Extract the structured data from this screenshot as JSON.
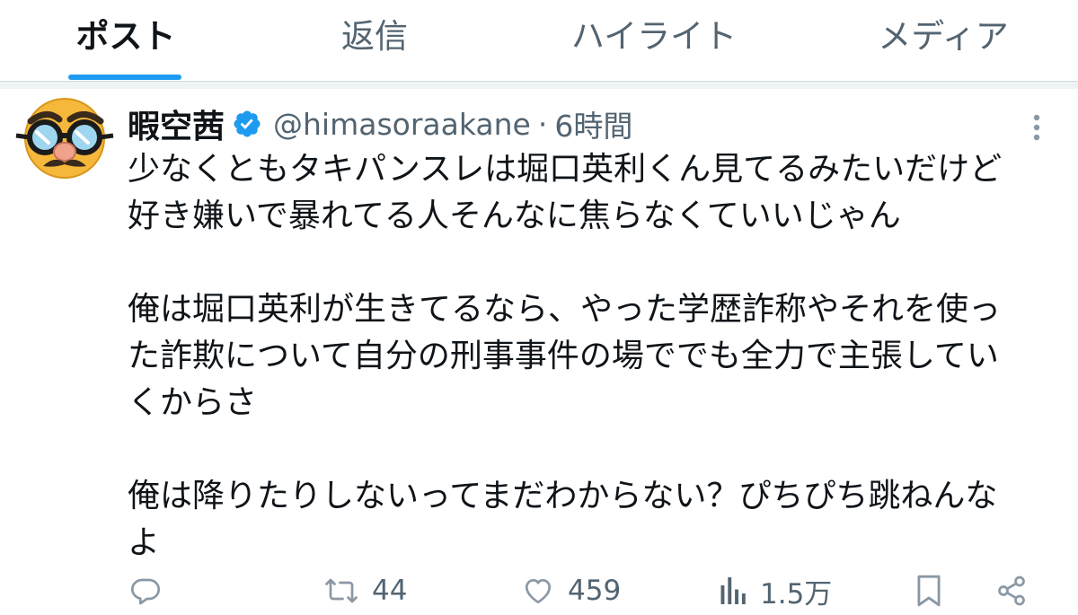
{
  "tabs": [
    {
      "label": "ポスト",
      "active": true
    },
    {
      "label": "返信",
      "active": false
    },
    {
      "label": "ハイライト",
      "active": false
    },
    {
      "label": "メディア",
      "active": false
    }
  ],
  "post": {
    "author_name": "暇空茜",
    "verified_icon": "verified-badge-icon",
    "handle": "@himasoraakane",
    "separator": "·",
    "time": "6時間",
    "avatar_icon": "disguise-glasses-face-emoji",
    "text": "少なくともタキパンスレは堀口英利くん見てるみたいだけど\n好き嫌いで暴れてる人そんなに焦らなくていいじゃん\n\n俺は堀口英利が生きてるなら、やった学歴詐称やそれを使っ\nた詐欺について自分の刑事事件の場ででも全力で主張してい\nくからさ\n\n俺は降りたりしないってまだわからない？ぴちぴち跳ねんな\nよ"
  },
  "actions": {
    "reply": {
      "icon": "reply-icon",
      "count": ""
    },
    "repost": {
      "icon": "repost-icon",
      "count": "44"
    },
    "like": {
      "icon": "heart-icon",
      "count": "459"
    },
    "views": {
      "icon": "analytics-icon",
      "count": "1.5万"
    },
    "bookmark": {
      "icon": "bookmark-icon"
    },
    "share": {
      "icon": "share-icon"
    }
  },
  "colors": {
    "accent": "#1d9bf0",
    "text_primary": "#0f1419",
    "text_secondary": "#536471",
    "divider": "#cfd9de"
  }
}
